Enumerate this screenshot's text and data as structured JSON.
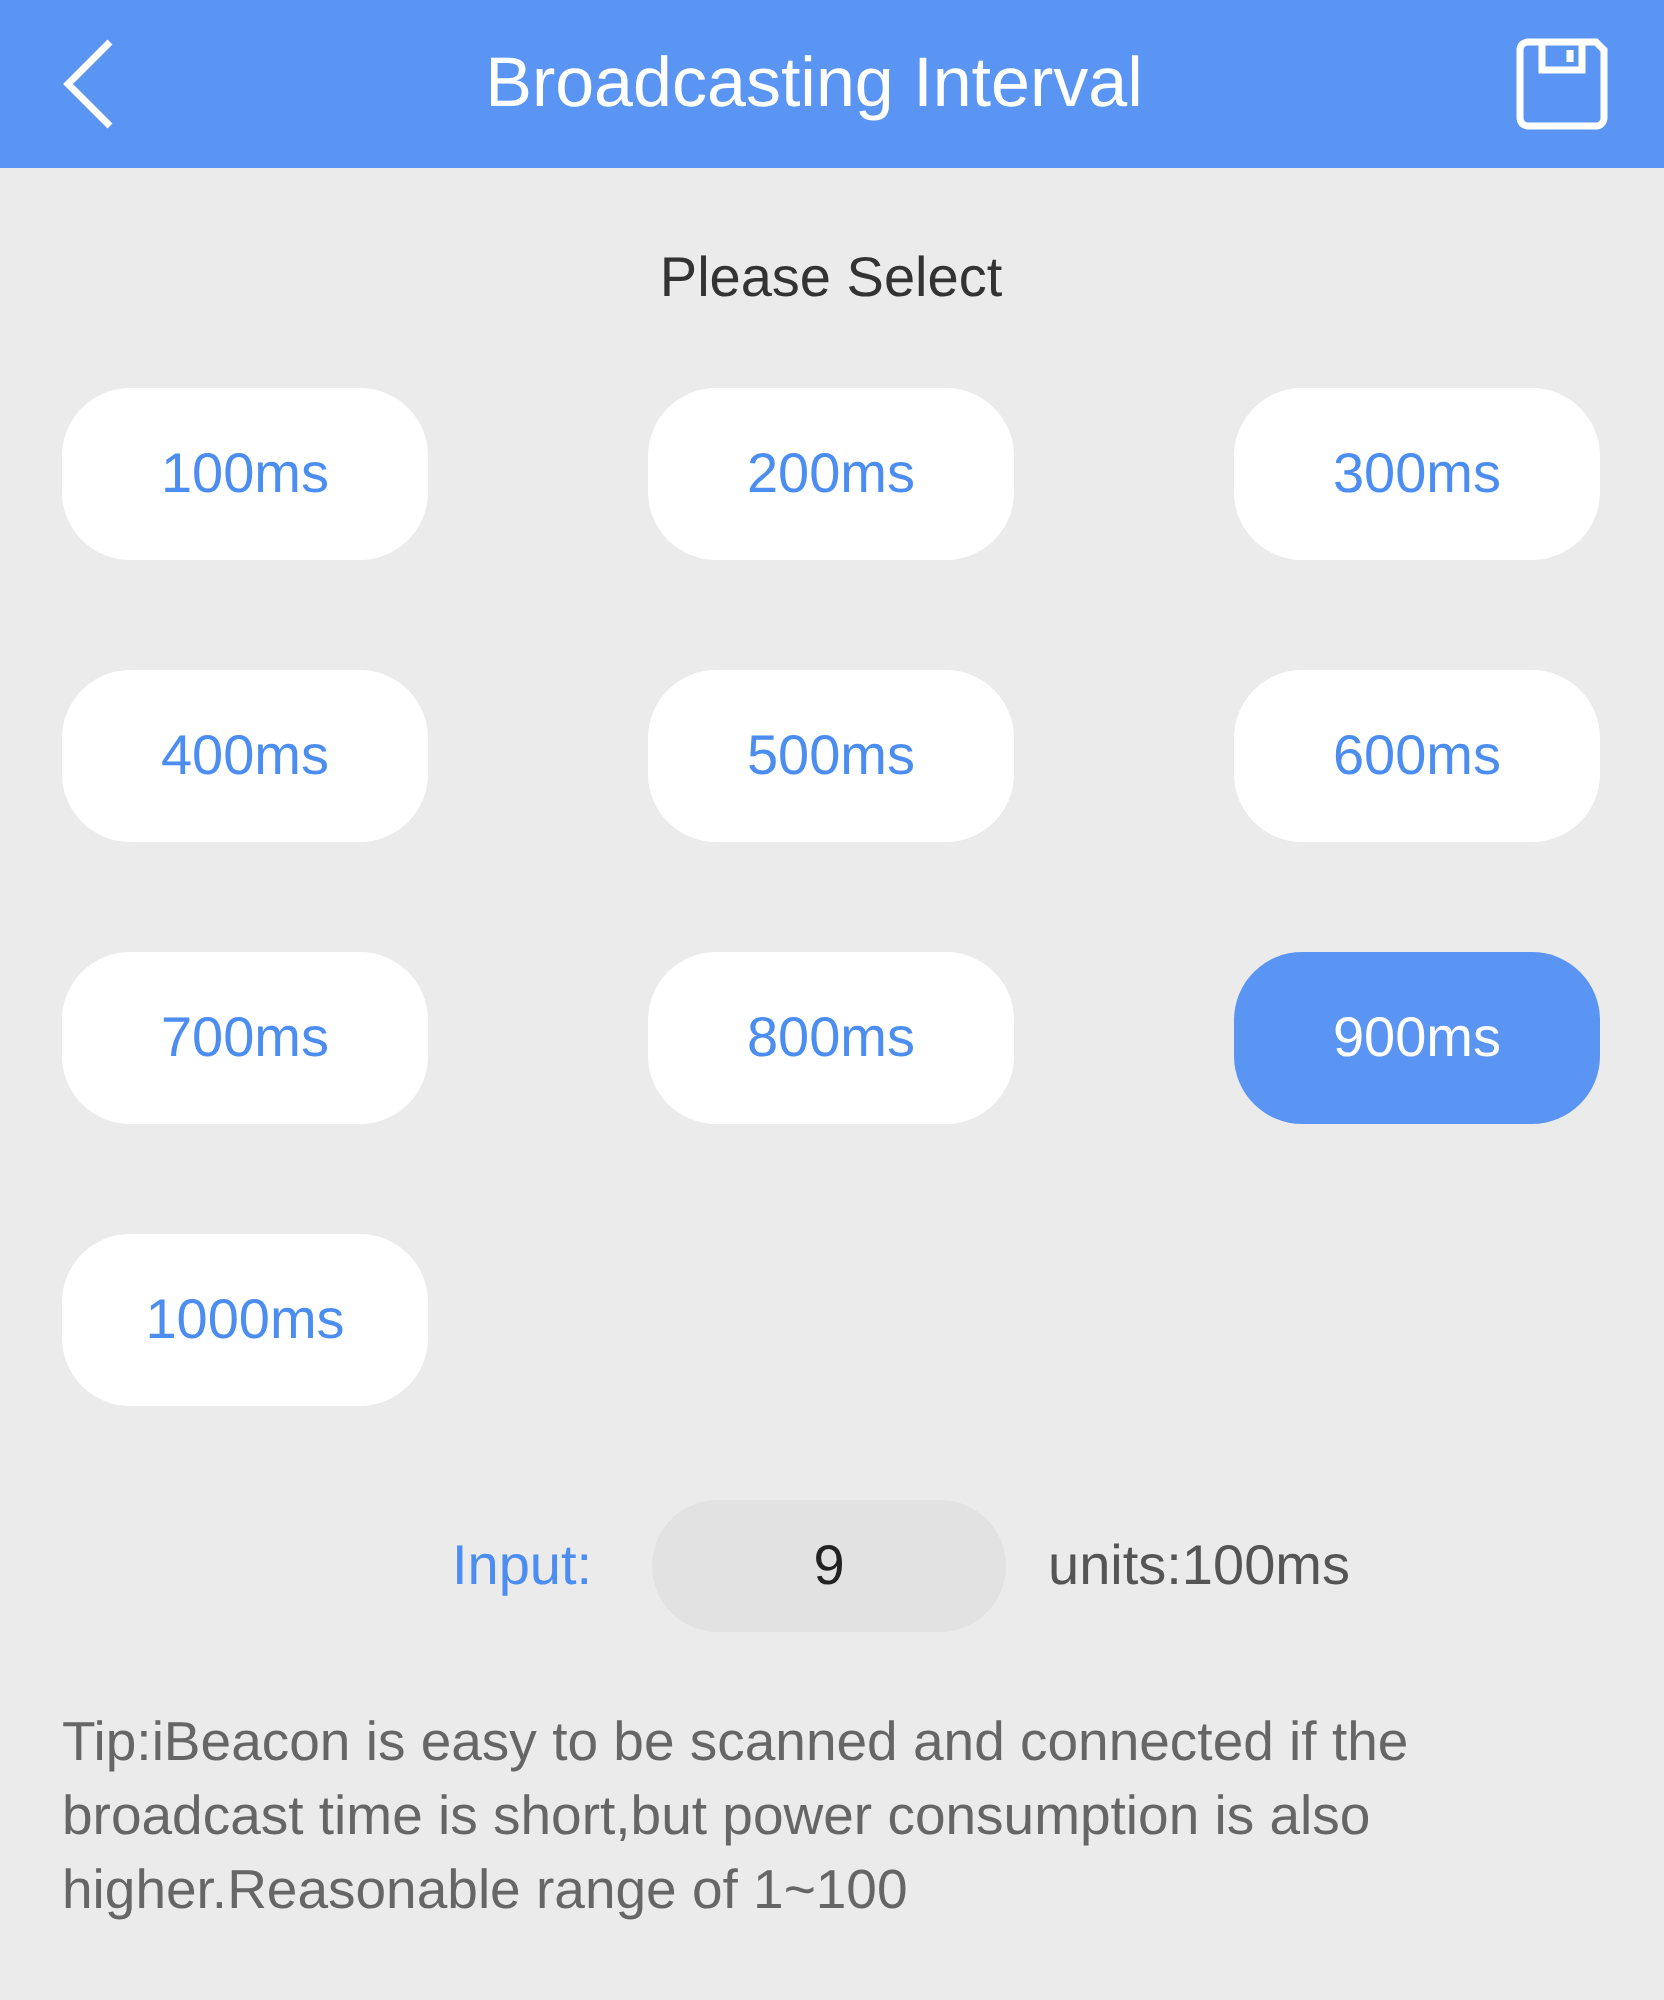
{
  "header": {
    "title": "Broadcasting Interval"
  },
  "prompt": "Please Select",
  "options": [
    {
      "label": "100ms",
      "selected": false
    },
    {
      "label": "200ms",
      "selected": false
    },
    {
      "label": "300ms",
      "selected": false
    },
    {
      "label": "400ms",
      "selected": false
    },
    {
      "label": "500ms",
      "selected": false
    },
    {
      "label": "600ms",
      "selected": false
    },
    {
      "label": "700ms",
      "selected": false
    },
    {
      "label": "800ms",
      "selected": false
    },
    {
      "label": "900ms",
      "selected": true
    },
    {
      "label": "1000ms",
      "selected": false
    }
  ],
  "input": {
    "label": "Input:",
    "value": "9",
    "units": "units:100ms"
  },
  "tip": "Tip:iBeacon is easy to be scanned and connected if the broadcast time is short,but power consumption is also higher.Reasonable range of 1~100"
}
